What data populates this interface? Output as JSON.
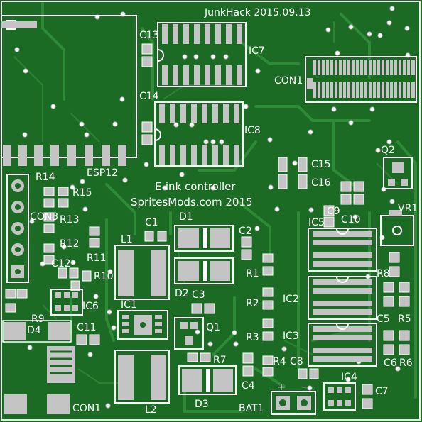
{
  "board": {
    "title": "JunkHack 2015.09.13",
    "subtitle": "E-ink controller",
    "credit": "SpritesMods.com 2015",
    "colors": {
      "board": "#1c6b25",
      "copper": "#2e8a37",
      "pad": "#c4c4c4",
      "silkscreen": "#ffffff",
      "outline": "#eaeaea"
    }
  },
  "labels": {
    "c13": "C13",
    "c14": "C14",
    "ic7": "IC7",
    "ic8": "IC8",
    "con1_top": "CON1",
    "esp12": "ESP12",
    "r14": "R14",
    "r15": "R15",
    "con3": "CON3",
    "r13": "R13",
    "r12": "R12",
    "r11": "R11",
    "c12": "C12",
    "r10": "R10",
    "r9": "R9",
    "ic6": "IC6",
    "d4": "D4",
    "c11": "C11",
    "con1_bottom": "CON1",
    "c15": "C15",
    "c16": "C16",
    "q2": "Q2",
    "vr1": "VR1",
    "c9": "C9",
    "c10": "C10",
    "ic5": "IC5",
    "r8": "R8",
    "ic2": "IC2",
    "c5": "C5",
    "r5": "R5",
    "ic3": "IC3",
    "c6": "C6",
    "r6": "R6",
    "ic4": "IC4",
    "c7": "C7",
    "c1": "C1",
    "d1": "D1",
    "c2": "C2",
    "l1": "L1",
    "r1": "R1",
    "d2": "D2",
    "c3": "C3",
    "r2": "R2",
    "ic1": "IC1",
    "q1": "Q1",
    "r3": "R3",
    "r7": "R7",
    "r4": "R4",
    "c8": "C8",
    "c4": "C4",
    "l2": "L2",
    "d3": "D3",
    "bat1": "BAT1",
    "plus": "+",
    "minus": "−"
  }
}
